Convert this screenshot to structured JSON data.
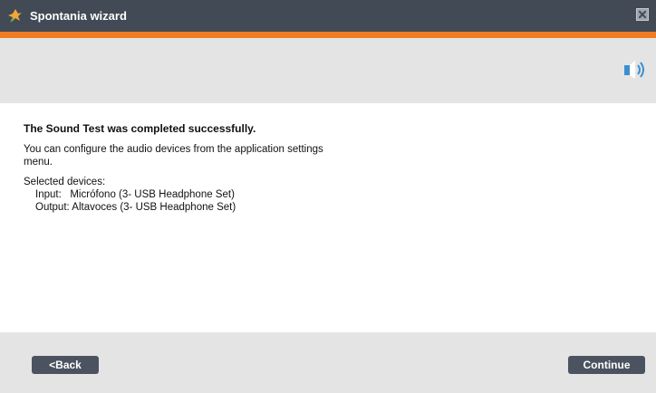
{
  "window": {
    "title": "Spontania wizard",
    "close_icon": "close-icon",
    "logo_icon": "spontania-logo-icon"
  },
  "header": {
    "icon": "speaker-icon"
  },
  "content": {
    "heading": "The Sound Test was completed successfully.",
    "description": "You can configure the audio devices from the application settings menu.",
    "devices_label": "Selected devices:",
    "input_row": "Input:   Micrófono (3- USB Headphone Set)",
    "output_row": "Output: Altavoces (3- USB Headphone Set)"
  },
  "footer": {
    "back_label": "<Back",
    "continue_label": "Continue"
  },
  "colors": {
    "titlebar": "#414a55",
    "accent": "#ef7c23",
    "panel": "#e4e4e4",
    "button": "#4b5360",
    "speaker": "#3b8fd1"
  }
}
